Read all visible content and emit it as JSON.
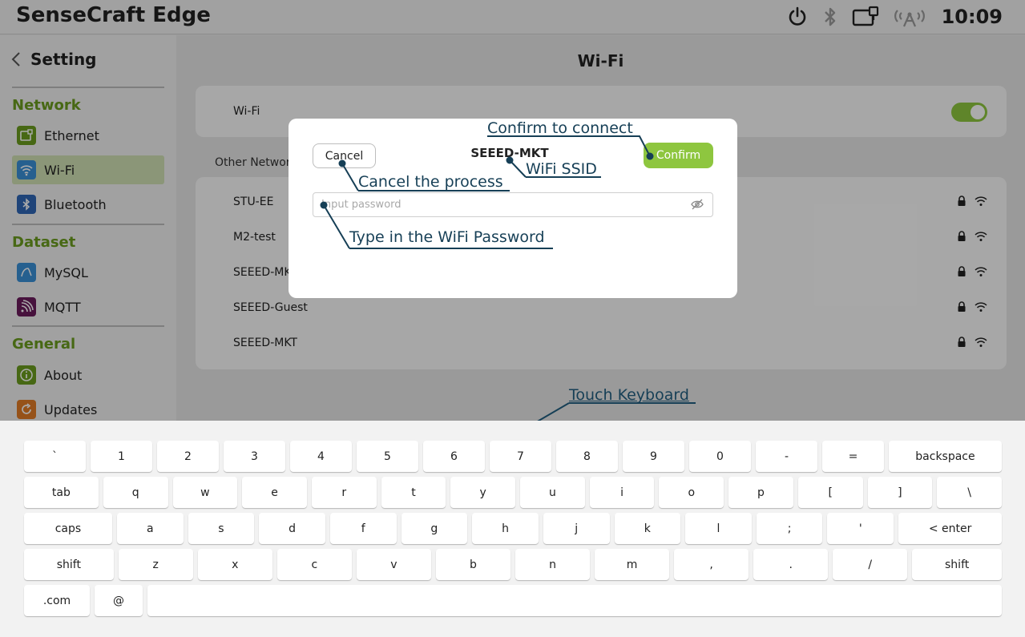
{
  "app_title": "SenseCraft Edge",
  "status_bar": {
    "time": "10:09",
    "icons": [
      "power-icon",
      "bluetooth-icon",
      "ethernet-icon",
      "cellular-icon"
    ]
  },
  "sidebar": {
    "back_title": "Setting",
    "sections": [
      {
        "title": "Network",
        "items": [
          {
            "label": "Ethernet",
            "icon": "ethernet-icon",
            "color": "#6a9c1f"
          },
          {
            "label": "Wi-Fi",
            "icon": "wifi-icon",
            "color": "#3a8fd6",
            "active": true
          },
          {
            "label": "Bluetooth",
            "icon": "bluetooth-icon",
            "color": "#2f66b5"
          }
        ]
      },
      {
        "title": "Dataset",
        "items": [
          {
            "label": "MySQL",
            "icon": "mysql-icon",
            "color": "#3a8fd6"
          },
          {
            "label": "MQTT",
            "icon": "mqtt-icon",
            "color": "#6b1b5c"
          }
        ]
      },
      {
        "title": "General",
        "items": [
          {
            "label": "About",
            "icon": "info-icon",
            "color": "#6a9c1f"
          },
          {
            "label": "Updates",
            "icon": "update-icon",
            "color": "#e07b26"
          }
        ]
      }
    ]
  },
  "main": {
    "title": "Wi-Fi",
    "wifi_toggle_label": "Wi-Fi",
    "wifi_enabled": true,
    "other_networks_label": "Other Networ",
    "networks": [
      {
        "name": "STU-EE"
      },
      {
        "name": "M2-test"
      },
      {
        "name": "SEEED-MK"
      },
      {
        "name": "SEEED-Guest"
      },
      {
        "name": "SEEED-MKT"
      }
    ]
  },
  "dialog": {
    "cancel_label": "Cancel",
    "ssid": "SEEED-MKT",
    "confirm_label": "Confirm",
    "password_placeholder": "Input password",
    "password_value": ""
  },
  "annotations": {
    "confirm": "Confirm to connect",
    "ssid": "WiFi SSID",
    "cancel": "Cancel the process",
    "password": "Type in the WiFi Password",
    "keyboard": "Touch Keyboard"
  },
  "keyboard": {
    "rows": [
      [
        "`",
        "1",
        "2",
        "3",
        "4",
        "5",
        "6",
        "7",
        "8",
        "9",
        "0",
        "-",
        "=",
        "backspace"
      ],
      [
        "tab",
        "q",
        "w",
        "e",
        "r",
        "t",
        "y",
        "u",
        "i",
        "o",
        "p",
        "[",
        "]",
        "\\"
      ],
      [
        "caps",
        "a",
        "s",
        "d",
        "f",
        "g",
        "h",
        "j",
        "k",
        "l",
        ";",
        "'",
        "< enter"
      ],
      [
        "shift",
        "z",
        "x",
        "c",
        "v",
        "b",
        "n",
        "m",
        ",",
        ".",
        "/",
        "shift"
      ],
      [
        ".com",
        "@",
        ""
      ]
    ]
  },
  "colors": {
    "accent": "#8ec63f",
    "section_title": "#6a9c1f",
    "annotation": "#163f56"
  }
}
